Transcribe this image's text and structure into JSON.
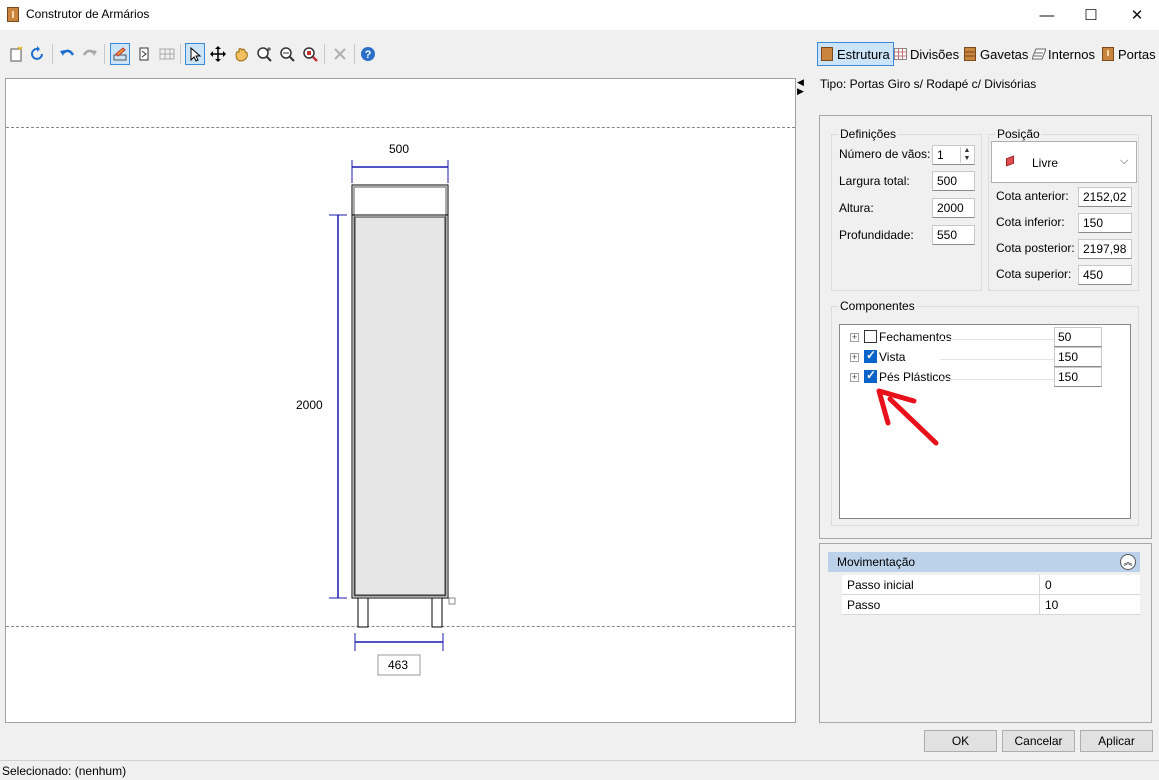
{
  "window": {
    "title": "Construtor de Armários",
    "controls": [
      "—",
      "☐",
      "✕"
    ]
  },
  "toolbar": {
    "icons": [
      "new-icon",
      "refresh-icon",
      "undo-icon",
      "redo-icon",
      "draw-mode-icon",
      "select-box-icon",
      "grid-icon",
      "pointer-icon",
      "move-icon",
      "pan-hand-icon",
      "zoom-in-icon",
      "zoom-out-icon",
      "zoom-fit-icon",
      "delete-icon",
      "help-icon"
    ]
  },
  "tabs": [
    {
      "label": "Estrutura",
      "selected": true
    },
    {
      "label": "Divisões",
      "selected": false
    },
    {
      "label": "Gavetas",
      "selected": false
    },
    {
      "label": "Internos",
      "selected": false
    },
    {
      "label": "Portas",
      "selected": false
    }
  ],
  "drawing": {
    "dim_top": "500",
    "dim_left": "2000",
    "dim_bottom": "463"
  },
  "type_text": "Tipo: Portas Giro s/ Rodapé c/ Divisórias",
  "definicoes": {
    "legend": "Definições",
    "num_vaos_label": "Número de vãos:",
    "num_vaos_value": "1",
    "largura_label": "Largura total:",
    "largura_value": "500",
    "altura_label": "Altura:",
    "altura_value": "2000",
    "profundidade_label": "Profundidade:",
    "profundidade_value": "550"
  },
  "posicao": {
    "legend": "Posição",
    "combo_value": "Livre",
    "cota_anterior_label": "Cota anterior:",
    "cota_anterior_value": "2152,02",
    "cota_inferior_label": "Cota inferior:",
    "cota_inferior_value": "150",
    "cota_posterior_label": "Cota posterior:",
    "cota_posterior_value": "2197,98",
    "cota_superior_label": "Cota superior:",
    "cota_superior_value": "450"
  },
  "componentes": {
    "legend": "Componentes",
    "items": [
      {
        "label": "Fechamentos",
        "checked": false,
        "value": "50"
      },
      {
        "label": "Vista",
        "checked": true,
        "value": "150"
      },
      {
        "label": "Pés Plásticos",
        "checked": true,
        "value": "150"
      }
    ]
  },
  "movimentacao": {
    "title": "Movimentação",
    "rows": [
      {
        "key": "Passo inicial",
        "value": "0"
      },
      {
        "key": "Passo",
        "value": "10"
      }
    ]
  },
  "buttons": {
    "ok": "OK",
    "cancel": "Cancelar",
    "apply": "Aplicar"
  },
  "status": "Selecionado: (nenhum)",
  "colors": {
    "accent": "#0a63c9",
    "annotation_arrow": "#e8101a",
    "dimension_line": "#1a1ab0",
    "header": "#bcd2ea"
  }
}
